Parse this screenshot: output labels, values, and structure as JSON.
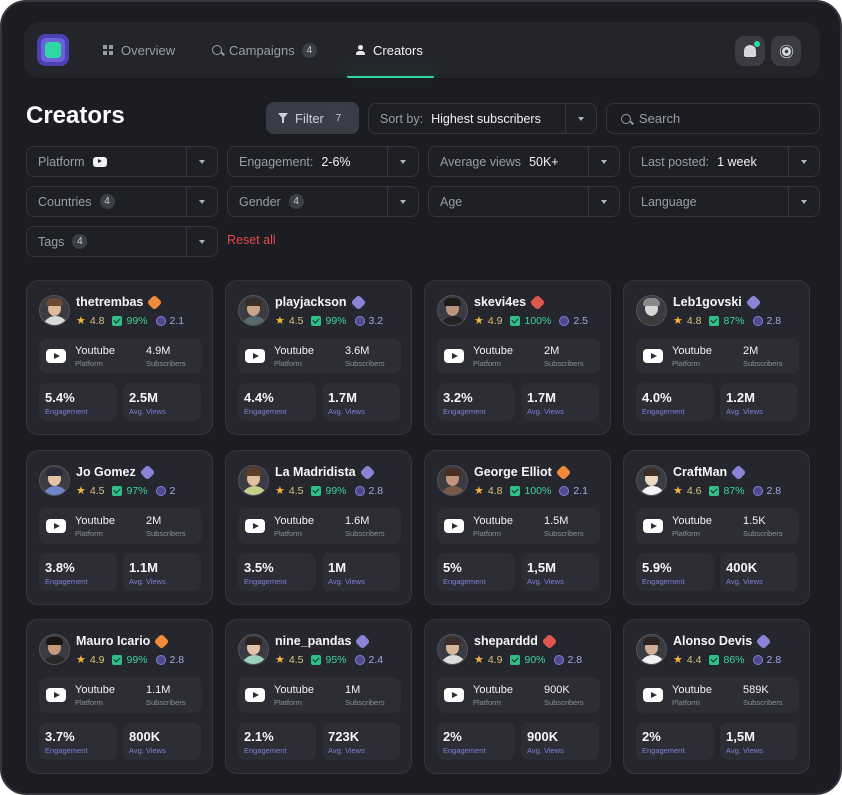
{
  "nav": {
    "tabs": [
      {
        "label": "Overview",
        "icon": "grid-icon"
      },
      {
        "label": "Campaigns",
        "icon": "search-icon",
        "count": "4"
      },
      {
        "label": "Creators",
        "icon": "people-icon",
        "active": true
      }
    ],
    "accent": "#2fd7a4"
  },
  "header": {
    "title": "Creators",
    "filter_label": "Filter",
    "filter_count": "7",
    "sort_label": "Sort by:",
    "sort_value": "Highest subscribers",
    "search_placeholder": "Search"
  },
  "filters": {
    "platform": "Platform",
    "engagement_label": "Engagement:",
    "engagement_value": "2-6%",
    "avg_views_label": "Average views",
    "avg_views_value": "50K+",
    "last_posted_label": "Last posted:",
    "last_posted_value": "1 week",
    "countries": "Countries",
    "countries_count": "4",
    "gender": "Gender",
    "gender_count": "4",
    "age": "Age",
    "language": "Language",
    "tags": "Tags",
    "tags_count": "4",
    "reset_all": "Reset all"
  },
  "card_labels": {
    "platform": "Platform",
    "subscribers": "Subscribers",
    "engagement": "Engagement",
    "avg_views": "Avg. Views"
  },
  "creators": [
    {
      "name": "thetrembas",
      "badge": "orange",
      "rating": "4.8",
      "er": "99%",
      "coins": "2.1",
      "platform": "Youtube",
      "subscribers": "4.9M",
      "engagement": "5.4%",
      "avg_views": "2.5M",
      "skin": "#e0b89a",
      "hair": "#6a4a35",
      "shirt": "#d9d9d9"
    },
    {
      "name": "playjackson",
      "badge": "purple",
      "rating": "4.5",
      "er": "99%",
      "coins": "3.2",
      "platform": "Youtube",
      "subscribers": "3.6M",
      "engagement": "4.4%",
      "avg_views": "1.7M",
      "skin": "#c9a489",
      "hair": "#3a2d26",
      "shirt": "#5b6a72"
    },
    {
      "name": "skevi4es",
      "badge": "red",
      "rating": "4.9",
      "er": "100%",
      "coins": "2.5",
      "platform": "Youtube",
      "subscribers": "2M",
      "engagement": "3.2%",
      "avg_views": "1.7M",
      "skin": "#b9957c",
      "hair": "#1f1b19",
      "shirt": "#222222"
    },
    {
      "name": "Leb1govski",
      "badge": "purple",
      "rating": "4.8",
      "er": "87%",
      "coins": "2.8",
      "platform": "Youtube",
      "subscribers": "2M",
      "engagement": "4.0%",
      "avg_views": "1.2M",
      "skin": "#d6d6d6",
      "hair": "#8a8a8a",
      "shirt": "#3b3b3b"
    },
    {
      "name": "Jo Gomez",
      "badge": "purple",
      "rating": "4.5",
      "er": "97%",
      "coins": "2",
      "platform": "Youtube",
      "subscribers": "2M",
      "engagement": "3.8%",
      "avg_views": "1.1M",
      "skin": "#e8c4a6",
      "hair": "#2b2b3a",
      "shirt": "#6f86c9"
    },
    {
      "name": "La Madridista",
      "badge": "purple",
      "rating": "4.5",
      "er": "99%",
      "coins": "2.8",
      "platform": "Youtube",
      "subscribers": "1.6M",
      "engagement": "3.5%",
      "avg_views": "1M",
      "skin": "#e3c09d",
      "hair": "#5c3d27",
      "shirt": "#c7d08a"
    },
    {
      "name": "George Elliot",
      "badge": "orange",
      "rating": "4.8",
      "er": "100%",
      "coins": "2.1",
      "platform": "Youtube",
      "subscribers": "1.5M",
      "engagement": "5%",
      "avg_views": "1,5M",
      "skin": "#c69478",
      "hair": "#4a3024",
      "shirt": "#7a5a48"
    },
    {
      "name": "CraftMan",
      "badge": "purple",
      "rating": "4.6",
      "er": "87%",
      "coins": "2.8",
      "platform": "Youtube",
      "subscribers": "1.5K",
      "engagement": "5.9%",
      "avg_views": "400K",
      "skin": "#efd7c6",
      "hair": "#3d2e27",
      "shirt": "#f4f4f4"
    },
    {
      "name": "Mauro Icario",
      "badge": "orange",
      "rating": "4.9",
      "er": "99%",
      "coins": "2.8",
      "platform": "Youtube",
      "subscribers": "1.1M",
      "engagement": "3.7%",
      "avg_views": "800K",
      "skin": "#c89a7c",
      "hair": "#1c1714",
      "shirt": "#2a2a2a"
    },
    {
      "name": "nine_pandas",
      "badge": "purple",
      "rating": "4.5",
      "er": "95%",
      "coins": "2.4",
      "platform": "Youtube",
      "subscribers": "1M",
      "engagement": "2.1%",
      "avg_views": "723K",
      "skin": "#e2c2a8",
      "hair": "#2a2321",
      "shirt": "#9fcfbf"
    },
    {
      "name": "sheparddd",
      "badge": "red",
      "rating": "4.9",
      "er": "90%",
      "coins": "2.8",
      "platform": "Youtube",
      "subscribers": "900K",
      "engagement": "2%",
      "avg_views": "900K",
      "skin": "#d9b59a",
      "hair": "#3b2e26",
      "shirt": "#dcdcdc"
    },
    {
      "name": "Alonso Devis",
      "badge": "purple",
      "rating": "4.4",
      "er": "86%",
      "coins": "2.8",
      "platform": "Youtube",
      "subscribers": "589K",
      "engagement": "2%",
      "avg_views": "1,5M",
      "skin": "#d0ad94",
      "hair": "#2c2420",
      "shirt": "#f0f0f0"
    }
  ],
  "badge_colors": {
    "orange": "#f08a3c",
    "purple": "#8b84d6",
    "red": "#e0574f"
  }
}
